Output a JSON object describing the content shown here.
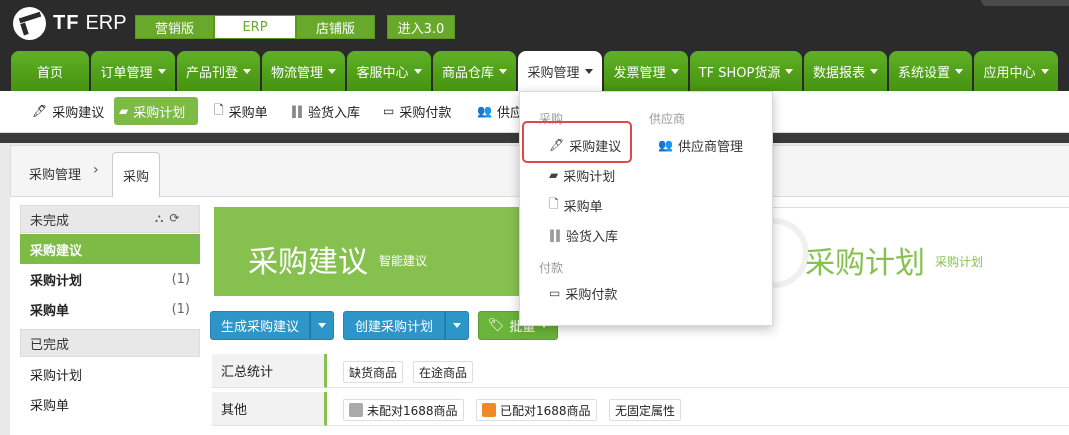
{
  "logo": {
    "brand": "TF",
    "product": "ERP"
  },
  "editions": [
    "营销版",
    "ERP",
    "店铺版"
  ],
  "upgrade_label": "进入3.0",
  "main_nav": [
    {
      "label": "首页",
      "has_caret": false
    },
    {
      "label": "订单管理",
      "has_caret": true
    },
    {
      "label": "产品刊登",
      "has_caret": true
    },
    {
      "label": "物流管理",
      "has_caret": true
    },
    {
      "label": "客服中心",
      "has_caret": true
    },
    {
      "label": "商品仓库",
      "has_caret": true
    },
    {
      "label": "采购管理",
      "has_caret": true,
      "active": true
    },
    {
      "label": "发票管理",
      "has_caret": true
    },
    {
      "label": "TF SHOP货源",
      "has_caret": true
    },
    {
      "label": "数据报表",
      "has_caret": true
    },
    {
      "label": "系统设置",
      "has_caret": true
    },
    {
      "label": "应用中心",
      "has_caret": true
    }
  ],
  "sub_nav": [
    {
      "label": "采购建议",
      "icon": "magic-wand-icon"
    },
    {
      "label": "采购计划",
      "icon": "book-icon",
      "active": true
    },
    {
      "label": "采购单",
      "icon": "file-icon"
    },
    {
      "label": "验货入库",
      "icon": "barcode-icon"
    },
    {
      "label": "采购付款",
      "icon": "credit-card-icon"
    },
    {
      "label": "供应",
      "icon": "users-icon"
    }
  ],
  "breadcrumb": {
    "root": "采购管理",
    "separator": "›",
    "current_tab": "采购"
  },
  "left_panel": {
    "incomplete_header": "未完成",
    "incomplete_items": [
      {
        "label": "采购建议",
        "count": "",
        "active": true
      },
      {
        "label": "采购计划",
        "count": "(1)"
      },
      {
        "label": "采购单",
        "count": "(1)"
      }
    ],
    "complete_header": "已完成",
    "complete_items": [
      {
        "label": "采购计划"
      },
      {
        "label": "采购单"
      }
    ]
  },
  "hero": {
    "title": "采购建议",
    "subtitle": "智能建议",
    "next_title": "采购计划",
    "next_subtitle": "采购计划"
  },
  "actions": {
    "generate": "生成采购建议",
    "create_plan": "创建采购计划",
    "batch": "批量"
  },
  "filters": {
    "summary_label": "汇总统计",
    "summary_chips": [
      "缺货商品",
      "在途商品"
    ],
    "other_label": "其他",
    "other_chips": [
      "未配对1688商品",
      "已配对1688商品",
      "无固定属性"
    ]
  },
  "dropdown": {
    "purchase_section": "采购",
    "purchase_items": [
      {
        "label": "采购建议",
        "icon": "magic-wand-icon",
        "highlighted": true
      },
      {
        "label": "采购计划",
        "icon": "book-icon"
      },
      {
        "label": "采购单",
        "icon": "file-icon"
      },
      {
        "label": "验货入库",
        "icon": "barcode-icon"
      }
    ],
    "payment_section": "付款",
    "payment_items": [
      {
        "label": "采购付款",
        "icon": "credit-card-icon"
      }
    ],
    "supplier_section": "供应商",
    "supplier_items": [
      {
        "label": "供应商管理",
        "icon": "users-icon"
      }
    ]
  },
  "colors": {
    "brand_green": "#6ab43b",
    "nav_dark": "#2b2b2b",
    "action_blue": "#2e95c9",
    "highlight_red": "#e04848"
  }
}
